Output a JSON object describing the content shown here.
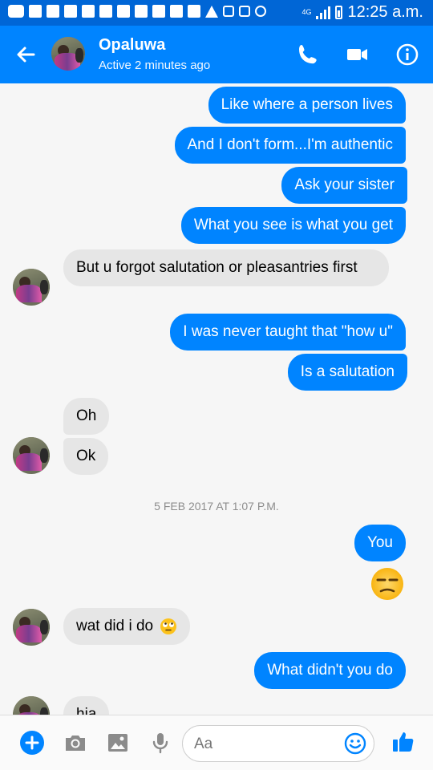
{
  "status_bar": {
    "network": "4G",
    "time": "12:25 a.m."
  },
  "header": {
    "back_icon": "arrow-back-icon",
    "contact_name": "Opaluwa",
    "contact_status": "Active 2 minutes ago",
    "call_icon": "phone-icon",
    "video_icon": "video-camera-icon",
    "info_icon": "info-icon"
  },
  "conversation": {
    "messages": [
      {
        "from": "me",
        "text": "Like where a person lives"
      },
      {
        "from": "me",
        "text": "And I don't form...I'm authentic"
      },
      {
        "from": "me",
        "text": "Ask your sister"
      },
      {
        "from": "me",
        "text": "What you see is what you get"
      },
      {
        "from": "them",
        "text": "But u forgot salutation or pleasantries first"
      },
      {
        "from": "me",
        "text": "I was never taught that \"how u\""
      },
      {
        "from": "me",
        "text": "Is a salutation"
      },
      {
        "from": "them",
        "text": "Oh"
      },
      {
        "from": "them",
        "text": "Ok"
      },
      {
        "from": "me",
        "text": "You"
      },
      {
        "from": "me",
        "emoji": "unamused-face-icon"
      },
      {
        "from": "them",
        "text": "wat did i do",
        "emoji": "rolling-eyes-face-icon"
      },
      {
        "from": "me",
        "text": "What didn't you do"
      },
      {
        "from": "them",
        "text": "hia"
      }
    ],
    "timestamp": "5 FEB 2017 AT 1:07 P.M."
  },
  "composer": {
    "placeholder": "Aa",
    "icons": [
      "plus-icon",
      "camera-icon",
      "gallery-icon",
      "microphone-icon",
      "emoji-icon",
      "thumbs-up-icon"
    ]
  },
  "colors": {
    "status_bar": "#0066d6",
    "header": "#0084ff",
    "outgoing_bubble": "#0084ff",
    "incoming_bubble": "#e6e6e6",
    "background": "#f6f6f6"
  }
}
